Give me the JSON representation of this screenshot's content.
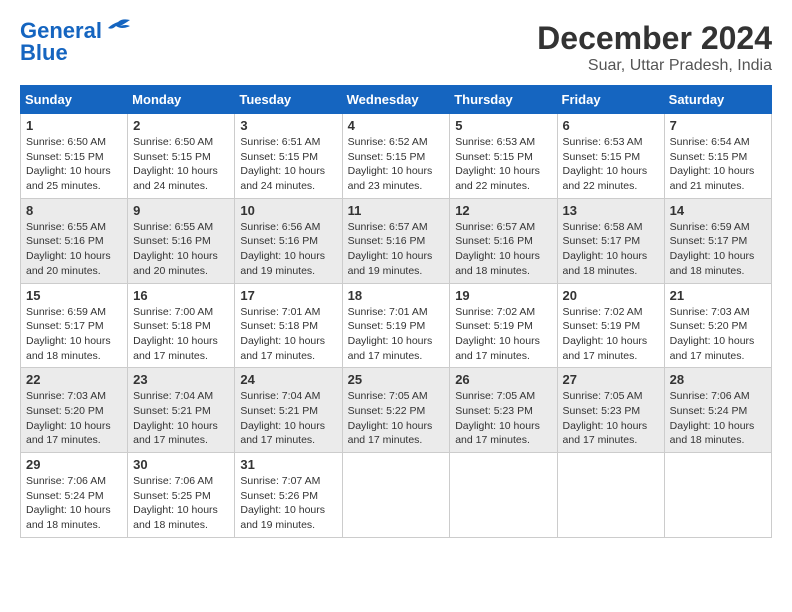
{
  "logo": {
    "line1": "General",
    "line2": "Blue"
  },
  "title": "December 2024",
  "subtitle": "Suar, Uttar Pradesh, India",
  "days_header": [
    "Sunday",
    "Monday",
    "Tuesday",
    "Wednesday",
    "Thursday",
    "Friday",
    "Saturday"
  ],
  "weeks": [
    [
      {
        "day": "1",
        "info": "Sunrise: 6:50 AM\nSunset: 5:15 PM\nDaylight: 10 hours\nand 25 minutes."
      },
      {
        "day": "2",
        "info": "Sunrise: 6:50 AM\nSunset: 5:15 PM\nDaylight: 10 hours\nand 24 minutes."
      },
      {
        "day": "3",
        "info": "Sunrise: 6:51 AM\nSunset: 5:15 PM\nDaylight: 10 hours\nand 24 minutes."
      },
      {
        "day": "4",
        "info": "Sunrise: 6:52 AM\nSunset: 5:15 PM\nDaylight: 10 hours\nand 23 minutes."
      },
      {
        "day": "5",
        "info": "Sunrise: 6:53 AM\nSunset: 5:15 PM\nDaylight: 10 hours\nand 22 minutes."
      },
      {
        "day": "6",
        "info": "Sunrise: 6:53 AM\nSunset: 5:15 PM\nDaylight: 10 hours\nand 22 minutes."
      },
      {
        "day": "7",
        "info": "Sunrise: 6:54 AM\nSunset: 5:15 PM\nDaylight: 10 hours\nand 21 minutes."
      }
    ],
    [
      {
        "day": "8",
        "info": "Sunrise: 6:55 AM\nSunset: 5:16 PM\nDaylight: 10 hours\nand 20 minutes."
      },
      {
        "day": "9",
        "info": "Sunrise: 6:55 AM\nSunset: 5:16 PM\nDaylight: 10 hours\nand 20 minutes."
      },
      {
        "day": "10",
        "info": "Sunrise: 6:56 AM\nSunset: 5:16 PM\nDaylight: 10 hours\nand 19 minutes."
      },
      {
        "day": "11",
        "info": "Sunrise: 6:57 AM\nSunset: 5:16 PM\nDaylight: 10 hours\nand 19 minutes."
      },
      {
        "day": "12",
        "info": "Sunrise: 6:57 AM\nSunset: 5:16 PM\nDaylight: 10 hours\nand 18 minutes."
      },
      {
        "day": "13",
        "info": "Sunrise: 6:58 AM\nSunset: 5:17 PM\nDaylight: 10 hours\nand 18 minutes."
      },
      {
        "day": "14",
        "info": "Sunrise: 6:59 AM\nSunset: 5:17 PM\nDaylight: 10 hours\nand 18 minutes."
      }
    ],
    [
      {
        "day": "15",
        "info": "Sunrise: 6:59 AM\nSunset: 5:17 PM\nDaylight: 10 hours\nand 18 minutes."
      },
      {
        "day": "16",
        "info": "Sunrise: 7:00 AM\nSunset: 5:18 PM\nDaylight: 10 hours\nand 17 minutes."
      },
      {
        "day": "17",
        "info": "Sunrise: 7:01 AM\nSunset: 5:18 PM\nDaylight: 10 hours\nand 17 minutes."
      },
      {
        "day": "18",
        "info": "Sunrise: 7:01 AM\nSunset: 5:19 PM\nDaylight: 10 hours\nand 17 minutes."
      },
      {
        "day": "19",
        "info": "Sunrise: 7:02 AM\nSunset: 5:19 PM\nDaylight: 10 hours\nand 17 minutes."
      },
      {
        "day": "20",
        "info": "Sunrise: 7:02 AM\nSunset: 5:19 PM\nDaylight: 10 hours\nand 17 minutes."
      },
      {
        "day": "21",
        "info": "Sunrise: 7:03 AM\nSunset: 5:20 PM\nDaylight: 10 hours\nand 17 minutes."
      }
    ],
    [
      {
        "day": "22",
        "info": "Sunrise: 7:03 AM\nSunset: 5:20 PM\nDaylight: 10 hours\nand 17 minutes."
      },
      {
        "day": "23",
        "info": "Sunrise: 7:04 AM\nSunset: 5:21 PM\nDaylight: 10 hours\nand 17 minutes."
      },
      {
        "day": "24",
        "info": "Sunrise: 7:04 AM\nSunset: 5:21 PM\nDaylight: 10 hours\nand 17 minutes."
      },
      {
        "day": "25",
        "info": "Sunrise: 7:05 AM\nSunset: 5:22 PM\nDaylight: 10 hours\nand 17 minutes."
      },
      {
        "day": "26",
        "info": "Sunrise: 7:05 AM\nSunset: 5:23 PM\nDaylight: 10 hours\nand 17 minutes."
      },
      {
        "day": "27",
        "info": "Sunrise: 7:05 AM\nSunset: 5:23 PM\nDaylight: 10 hours\nand 17 minutes."
      },
      {
        "day": "28",
        "info": "Sunrise: 7:06 AM\nSunset: 5:24 PM\nDaylight: 10 hours\nand 18 minutes."
      }
    ],
    [
      {
        "day": "29",
        "info": "Sunrise: 7:06 AM\nSunset: 5:24 PM\nDaylight: 10 hours\nand 18 minutes."
      },
      {
        "day": "30",
        "info": "Sunrise: 7:06 AM\nSunset: 5:25 PM\nDaylight: 10 hours\nand 18 minutes."
      },
      {
        "day": "31",
        "info": "Sunrise: 7:07 AM\nSunset: 5:26 PM\nDaylight: 10 hours\nand 19 minutes."
      },
      {
        "day": "",
        "info": ""
      },
      {
        "day": "",
        "info": ""
      },
      {
        "day": "",
        "info": ""
      },
      {
        "day": "",
        "info": ""
      }
    ]
  ]
}
